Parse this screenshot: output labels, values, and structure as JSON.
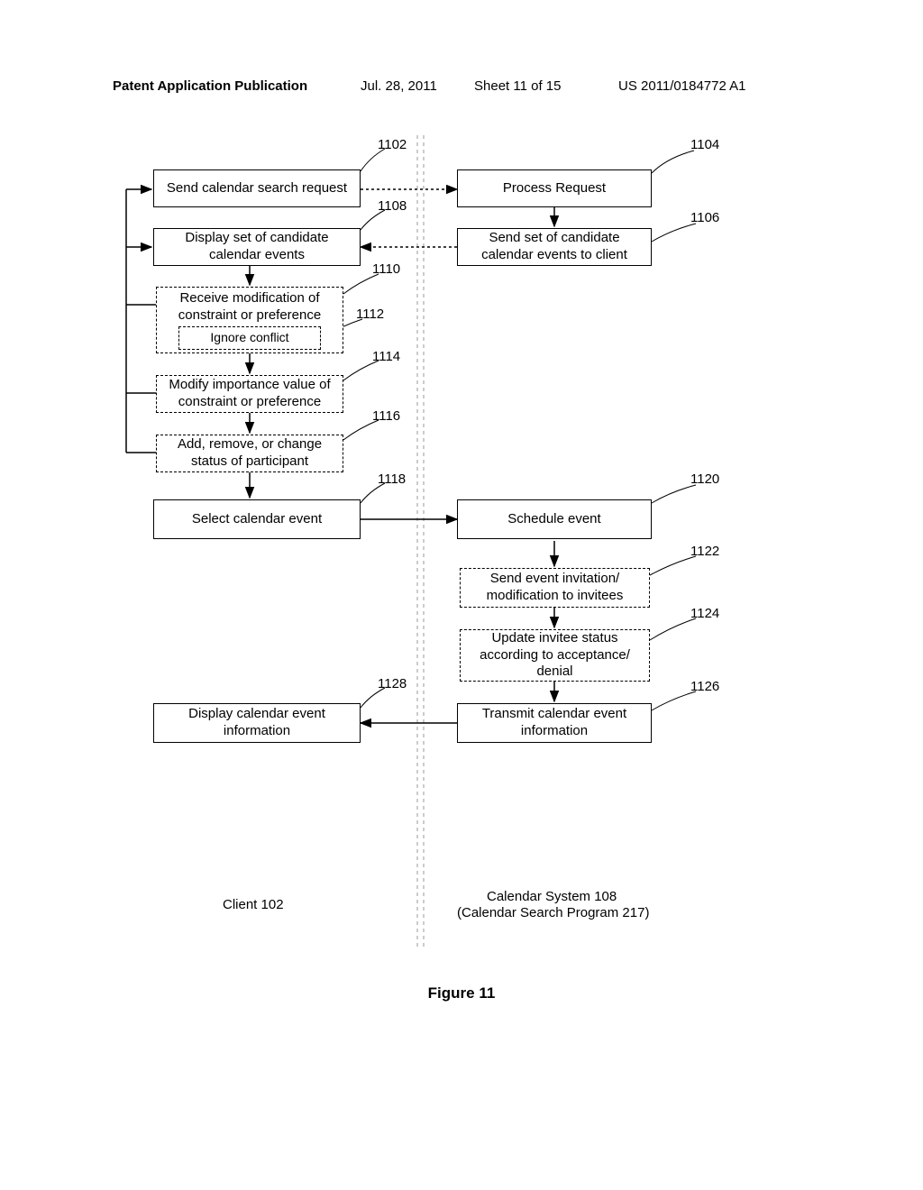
{
  "header": {
    "publication": "Patent Application Publication",
    "date": "Jul. 28, 2011",
    "sheet": "Sheet 11 of 15",
    "docnum": "US 2011/0184772 A1"
  },
  "boxes": {
    "b1102": "Send calendar search request",
    "b1104": "Process Request",
    "b1106": "Send set of candidate calendar events to client",
    "b1108": "Display set of candidate calendar events",
    "b1110": "Receive modification of constraint or preference",
    "b1112": "Ignore conflict",
    "b1114": "Modify importance value of constraint or preference",
    "b1116": "Add, remove, or change status of participant",
    "b1118": "Select calendar event",
    "b1120": "Schedule event",
    "b1122": "Send event invitation/ modification to invitees",
    "b1124": "Update invitee status according to acceptance/ denial",
    "b1126": "Transmit calendar event information",
    "b1128": "Display calendar event information"
  },
  "refs": {
    "r1102": "1102",
    "r1104": "1104",
    "r1106": "1106",
    "r1108": "1108",
    "r1110": "1110",
    "r1112": "1112",
    "r1114": "1114",
    "r1116": "1116",
    "r1118": "1118",
    "r1120": "1120",
    "r1122": "1122",
    "r1124": "1124",
    "r1126": "1126",
    "r1128": "1128"
  },
  "columns": {
    "left": "Client 102",
    "right_l1": "Calendar System 108",
    "right_l2": "(Calendar Search Program 217)"
  },
  "figure": "Figure 11"
}
